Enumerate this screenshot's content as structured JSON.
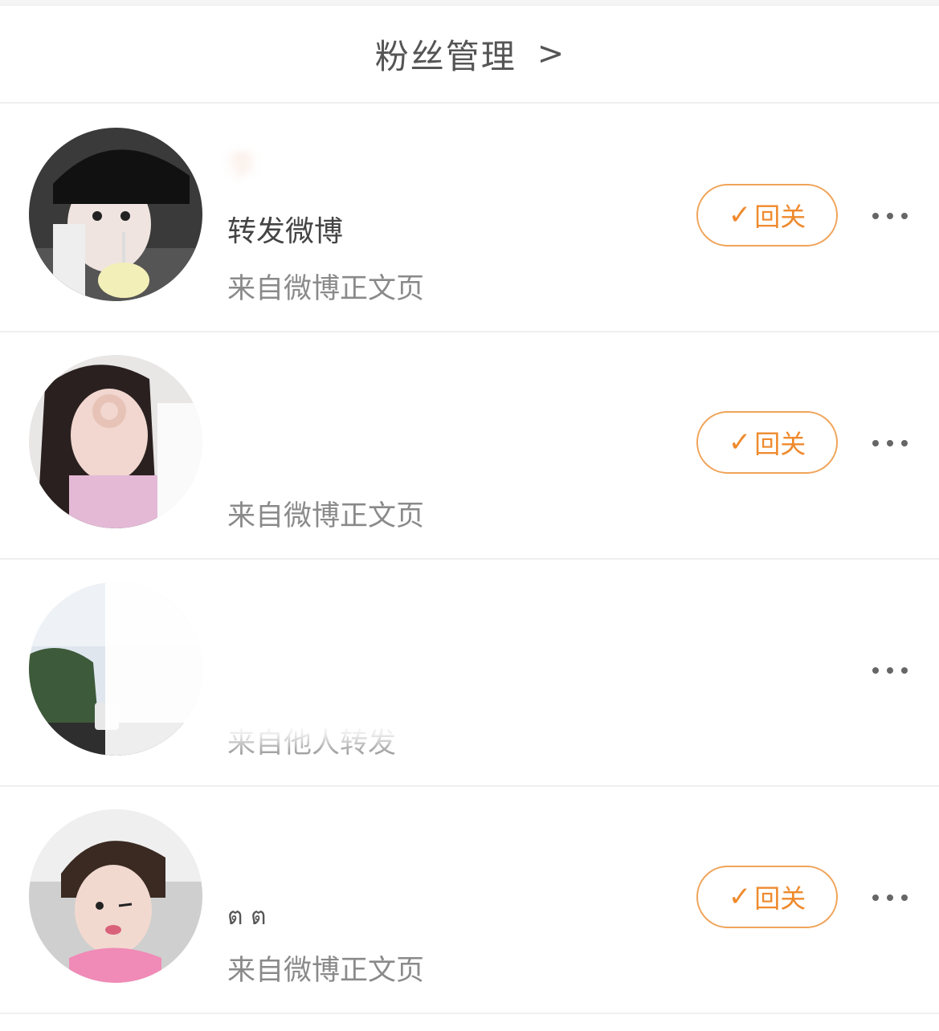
{
  "header": {
    "title": "粉丝管理",
    "chevron": ">"
  },
  "rows": [
    {
      "name": "李",
      "subtext": "转发微博",
      "source": "来自微博正文页",
      "button": {
        "check": "✓",
        "label": "回关"
      },
      "more_icon": "more-horizontal-icon"
    },
    {
      "name": "",
      "subtext": "",
      "source": "来自微博正文页",
      "button": {
        "check": "✓",
        "label": "回关"
      },
      "more_icon": "more-horizontal-icon"
    },
    {
      "name": "",
      "subtext": "",
      "source": "来自他人转发",
      "button": null,
      "more_icon": "more-horizontal-icon"
    },
    {
      "name": "",
      "subtext": "ต ต",
      "source": "来自微博正文页",
      "button": {
        "check": "✓",
        "label": "回关"
      },
      "more_icon": "more-horizontal-icon"
    }
  ],
  "colors": {
    "accent": "#ef8a2d",
    "button_border": "#f0a45a",
    "secondary_text": "#8a8a8a",
    "divider": "#efefef"
  }
}
